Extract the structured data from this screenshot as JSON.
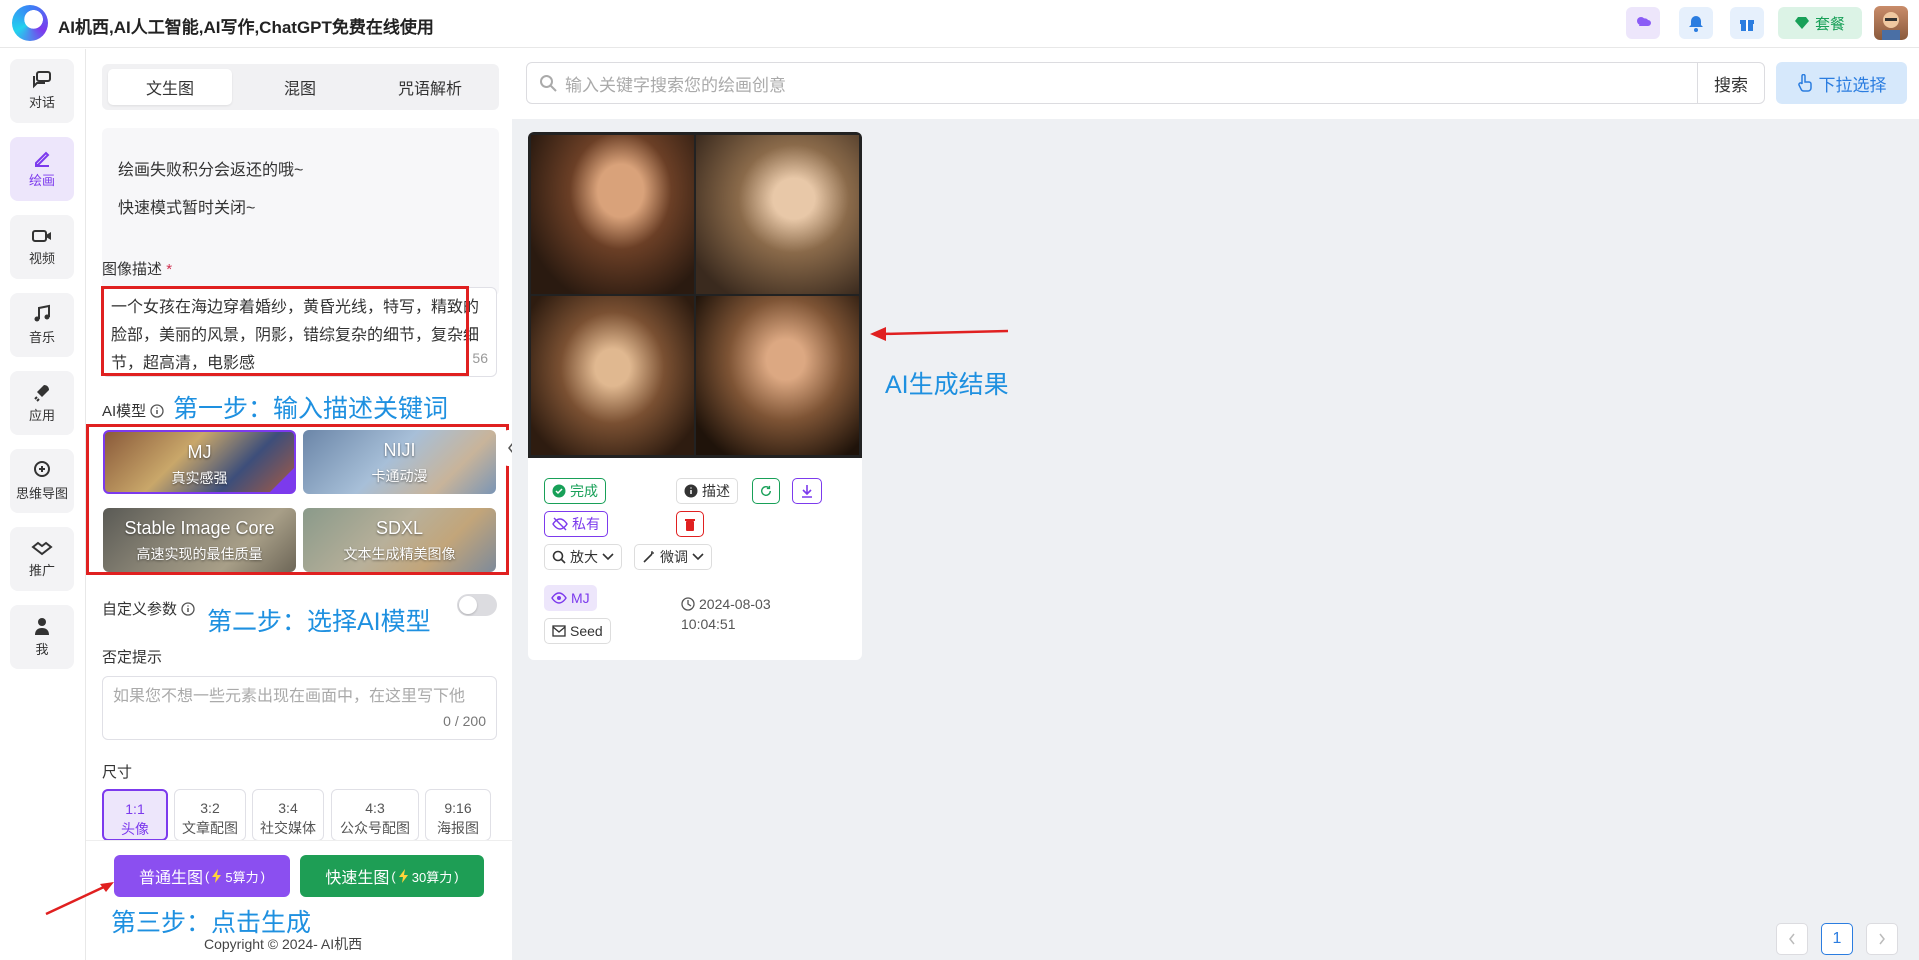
{
  "app": {
    "title": "AI机西,AI人工智能,AI写作,ChatGPT免费在线使用",
    "plan_label": "套餐"
  },
  "sidenav": {
    "items": [
      {
        "label": "对话"
      },
      {
        "label": "绘画"
      },
      {
        "label": "视频"
      },
      {
        "label": "音乐"
      },
      {
        "label": "应用"
      },
      {
        "label": "思维导图"
      },
      {
        "label": "推广"
      },
      {
        "label": "我"
      }
    ]
  },
  "tabs": [
    {
      "label": "文生图"
    },
    {
      "label": "混图"
    },
    {
      "label": "咒语解析"
    }
  ],
  "notice": {
    "line1": "绘画失败积分会返还的哦~",
    "line2": "快速模式暂时关闭~"
  },
  "prompt": {
    "label": "图像描述",
    "required_mark": "*",
    "value": "一个女孩在海边穿着婚纱，黄昏光线，特写，精致的脸部，美丽的风景，阴影，错综复杂的细节，复杂细节，超高清，电影感",
    "count": "56"
  },
  "model": {
    "label": "AI模型",
    "options": [
      {
        "title": "MJ",
        "subtitle": "真实感强"
      },
      {
        "title": "NIJI",
        "subtitle": "卡通动漫"
      },
      {
        "title": "Stable Image Core",
        "subtitle": "高速实现的最佳质量"
      },
      {
        "title": "SDXL",
        "subtitle": "文本生成精美图像"
      }
    ]
  },
  "custom_params": {
    "label": "自定义参数"
  },
  "negative": {
    "label": "否定提示",
    "placeholder": "如果您不想一些元素出现在画面中，在这里写下他",
    "count": "0 / 200"
  },
  "size": {
    "label": "尺寸",
    "options": [
      {
        "ratio": "1:1",
        "name": "头像"
      },
      {
        "ratio": "3:2",
        "name": "文章配图"
      },
      {
        "ratio": "3:4",
        "name": "社交媒体"
      },
      {
        "ratio": "4:3",
        "name": "公众号配图"
      },
      {
        "ratio": "9:16",
        "name": "海报图"
      }
    ]
  },
  "actions": {
    "normal": {
      "label": "普通生图",
      "cost": "5算力"
    },
    "fast": {
      "label": "快速生图",
      "cost": "30算力"
    }
  },
  "search": {
    "placeholder": "输入关键字搜索您的绘画创意",
    "button": "搜索",
    "dropdown": "下拉选择"
  },
  "result": {
    "status": "完成",
    "describe": "描述",
    "private": "私有",
    "zoom": "放大",
    "tweak": "微调",
    "model": "MJ",
    "seed": "Seed",
    "date": "2024-08-03",
    "time": "10:04:51"
  },
  "annotations": {
    "step1": "第一步：输入描述关键词",
    "step2": "第二步：选择AI模型",
    "step3": "第三步：点击生成",
    "result": "AI生成结果"
  },
  "pager": {
    "current": "1"
  },
  "footer": {
    "copyright": "Copyright © 2024-  AI机西"
  },
  "colors": {
    "accent": "#7c3aed",
    "green": "#18a058",
    "annotation": "#1e90e0",
    "highlight": "#e02020"
  }
}
